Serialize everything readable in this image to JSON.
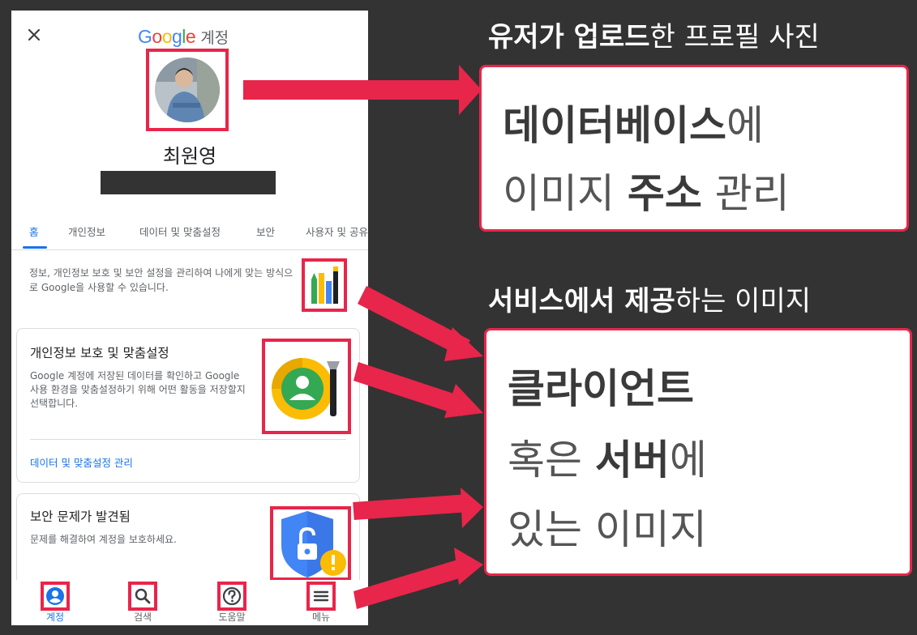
{
  "header": {
    "close_icon": "close-icon",
    "brand_word": "Google",
    "brand_suffix": "계정"
  },
  "profile": {
    "name": "최원영",
    "avatar_icon": "profile-photo"
  },
  "tabs": [
    {
      "label": "홈",
      "active": true
    },
    {
      "label": "개인정보"
    },
    {
      "label": "데이터 및 맞춤설정"
    },
    {
      "label": "보안"
    },
    {
      "label": "사용자 및 공유"
    }
  ],
  "intro": {
    "text": "정보, 개인정보 보호 및 보안 설정을 관리하여 나에게 맞는 방식으로 Google을 사용할 수 있습니다."
  },
  "cards": {
    "privacy": {
      "title": "개인정보 보호 및 맞춤설정",
      "description": "Google 계정에 저장된 데이터를 확인하고 Google 사용 환경을 맞춤설정하기 위해 어떤 활동을 저장할지 선택합니다.",
      "link": "데이터 및 맞춤설정 관리"
    },
    "security": {
      "title": "보안 문제가 발견됨",
      "description": "문제를 해결하여 계정을 보호하세요."
    }
  },
  "bottom_nav": [
    {
      "label": "계정",
      "icon": "account-icon",
      "active": true
    },
    {
      "label": "검색",
      "icon": "search-icon"
    },
    {
      "label": "도움말",
      "icon": "help-icon"
    },
    {
      "label": "메뉴",
      "icon": "menu-icon"
    }
  ],
  "annotations": {
    "heading1": {
      "bold": "유저가 업로드",
      "rest": "한 프로필 사진"
    },
    "callout1": {
      "line1_bold": "데이터베이스",
      "line1_rest": "에",
      "line2_a": "이미지 ",
      "line2_bold": "주소",
      "line2_b": " 관리"
    },
    "heading2": {
      "bold": "서비스에서 제공",
      "rest": "하는 이미지"
    },
    "callout2": {
      "line1_bold": "클라이언트",
      "line2_a": "혹은 ",
      "line2_bold": "서버",
      "line2_b": "에",
      "line3": "있는 이미지"
    }
  },
  "colors": {
    "highlight": "#e8254a",
    "background": "#333333",
    "google_blue": "#1a73e8"
  }
}
